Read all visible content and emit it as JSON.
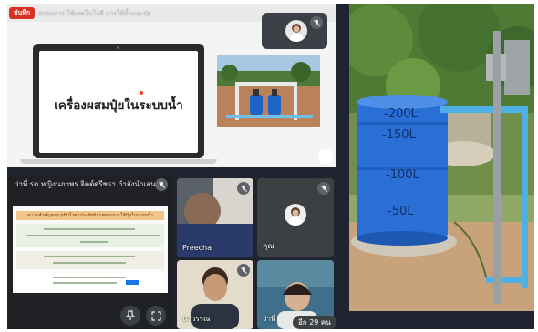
{
  "recording": {
    "label": "บันทึก"
  },
  "presentation": {
    "meeting_title": "อบรมการ ใช้เทคโนโลยี การให้น้ำและปุ๋ย",
    "slide_heading": "เครื่องผสมปุ๋ยในระบบน้ำ"
  },
  "screen_share": {
    "presenter_label": "ว่าที่ รต.หญิงนภาพร จิตต์ศรีชรา กำลังนำเสนอ",
    "doc_heading": "ความสำคัญของ pH น้ำต่อประสิทธิภาพของการใช้ปุ๋ยในระบบน้ำ",
    "pin_icon": "pin-icon",
    "fullscreen_icon": "fullscreen-icon"
  },
  "participants": [
    {
      "name": "Preecha"
    },
    {
      "name": "คุณ"
    },
    {
      "name": "นาวรรณ"
    },
    {
      "name": "ว่าที่"
    }
  ],
  "participant_count": "อีก 29 คน",
  "colors": {
    "tile_bg": "#3c4043",
    "stage_bg": "#1f2430",
    "record_red": "#d93025",
    "barrel_blue": "#2a6fd6",
    "pipe_blue": "#4fb0e6"
  }
}
